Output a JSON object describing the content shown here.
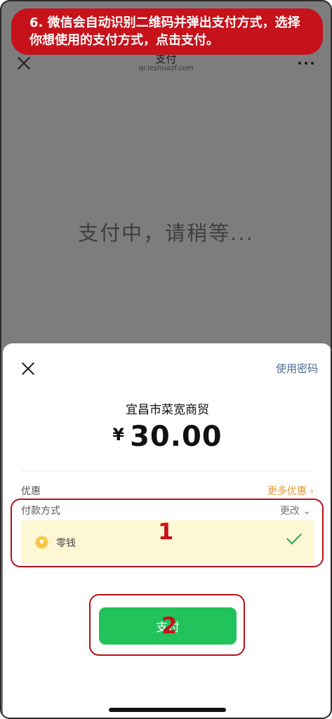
{
  "instruction": "6. 微信会自动识别二维码并弹出支付方式，选择你想使用的支付方式，点击支付。",
  "webview": {
    "title": "支付",
    "url": "qr.leshuazf.com",
    "status_text": "支付中，请稍等..."
  },
  "sheet": {
    "use_password_label": "使用密码",
    "merchant_name": "宜昌市菜宽商贸",
    "currency_symbol": "¥",
    "amount": "30.00",
    "discount_label": "优惠",
    "more_discount_label": "更多优惠 ›",
    "payment_method_label": "付款方式",
    "change_label": "更改 ⌄",
    "selected_method": "零钱",
    "coin_glyph": "¥",
    "pay_button_label": "支付"
  },
  "annotations": {
    "step_1": "1",
    "step_2": "2"
  },
  "colors": {
    "accent_green": "#22c35a",
    "banner_red": "#c6121b",
    "link_blue": "#4e6a96",
    "discount_orange": "#e19a36"
  }
}
